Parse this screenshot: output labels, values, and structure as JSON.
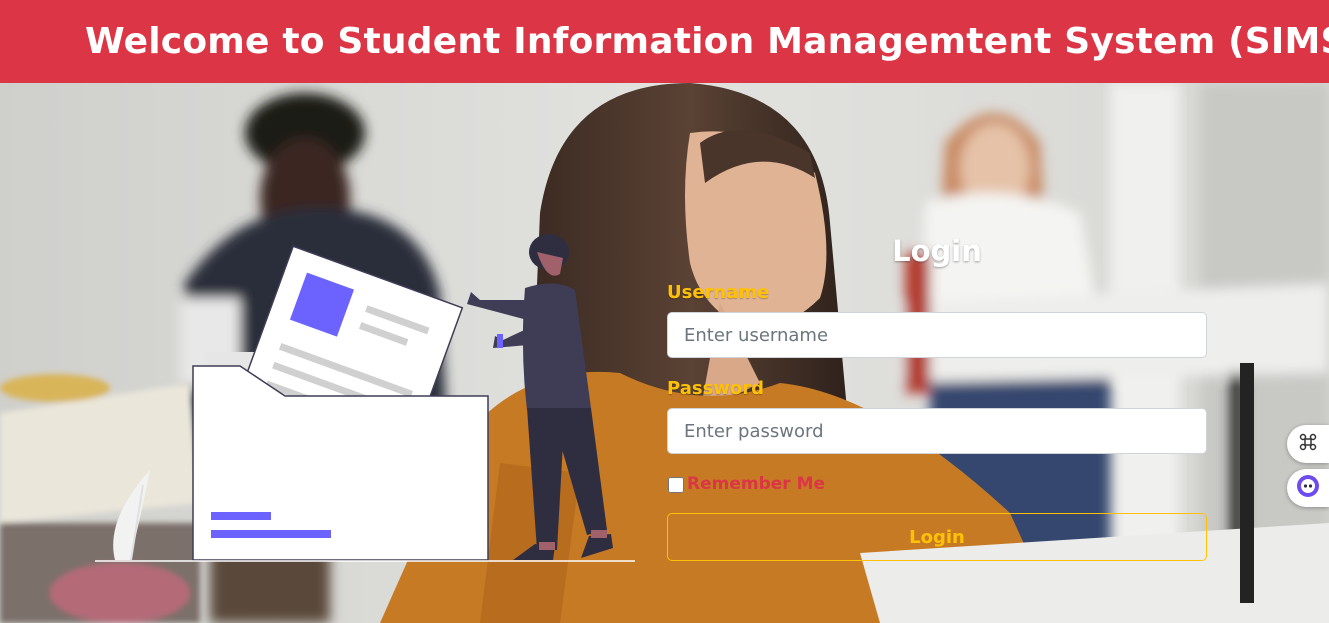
{
  "header": {
    "title": "Welcome to Student Information Managemtent System (SIMS)"
  },
  "colors": {
    "header_bg": "#dc3545",
    "label": "#ffc107",
    "remember": "#dc3545",
    "accent_purple": "#6c63ff"
  },
  "login": {
    "title": "Login",
    "username_label": "Username",
    "username_placeholder": "Enter username",
    "password_label": "Password",
    "password_placeholder": "Enter password",
    "remember_label": "Remember Me",
    "submit_label": "Login"
  },
  "side_widgets": {
    "top_icon": "command-icon",
    "bottom_icon": "assistant-icon"
  },
  "illustration": {
    "icon": "person-filing-document-illustration"
  }
}
